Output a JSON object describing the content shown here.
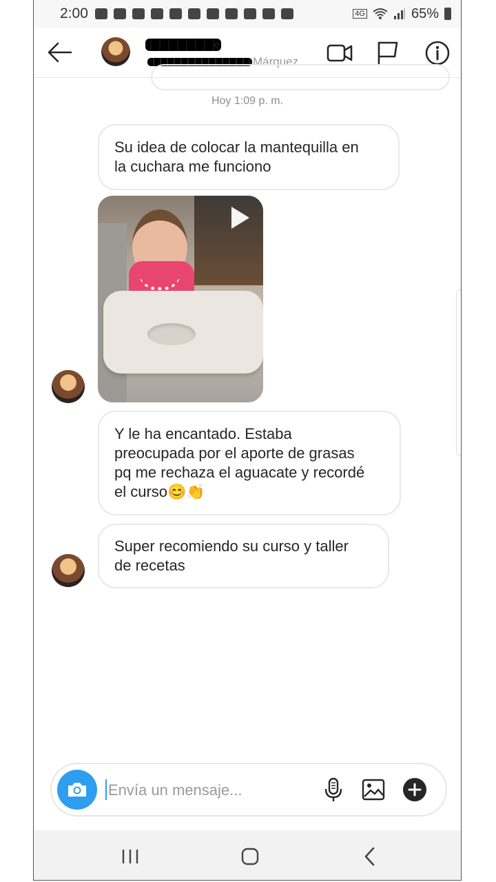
{
  "status_bar": {
    "time": "2:00",
    "network": "4G",
    "battery": "65%"
  },
  "header": {
    "name_visible_suffix": "e",
    "subname_visible_suffix": "Márquez"
  },
  "conversation": {
    "timestamp": "Hoy 1:09 p. m.",
    "messages": [
      "Su idea de colocar la mantequilla en\nla cuchara me funciono",
      "Y le ha encantado. Estaba\npreocupada por el aporte de grasas\npq me rechaza el aguacate y recordé\nel curso😊👏",
      "Super recomiendo su curso y taller\nde recetas"
    ]
  },
  "composer": {
    "placeholder": "Envía un mensaje..."
  },
  "icons": {
    "back": "arrow-left-icon",
    "video_call": "video-camera-icon",
    "flag": "flag-icon",
    "info": "info-icon",
    "camera": "camera-icon",
    "mic": "microphone-icon",
    "gallery": "image-icon",
    "plus": "plus-icon",
    "play": "play-icon"
  },
  "colors": {
    "accent": "#2e9ef1",
    "text": "#262626",
    "muted": "#8e8e8e"
  }
}
